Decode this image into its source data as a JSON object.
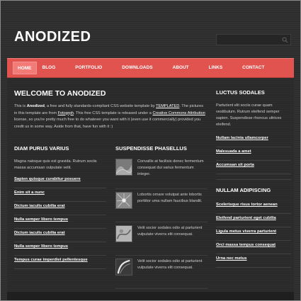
{
  "site": {
    "logo": "ANODIZED"
  },
  "search": {
    "placeholder": ""
  },
  "nav": {
    "items": [
      "HOME",
      "BLOG",
      "PORTFOLIO",
      "DOWNLOADS",
      "ABOUT",
      "LINKS",
      "CONTACT"
    ],
    "active": "HOME"
  },
  "welcome": {
    "title": "WELCOME TO ANODIZED",
    "p1": "This is ",
    "brand": "Anodized",
    "p2": ", a free and fully standards-compliant CSS website template by ",
    "templated": "TEMPLATED",
    "p3": ". The pictures in this template are from ",
    "fotogrph": "Fotogrph",
    "p4": ". This free CSS template is released under a ",
    "license": "Creative Commons Attribution",
    "p5": " license, so you're pretty much free to do whatever you want with it (even use it commercially) provided you credit us in some way. Aside from that, have fun with it :)"
  },
  "col1": {
    "title": "DIAM PURUS VARIUS",
    "text": "Magna natoque quis est gravida. Rutrum sociis massa accumsan vulputate velit.",
    "links": [
      "Sapien quisque curabitur posuere",
      "Enim sit a nunc",
      "Dictum iaculis cubilia erat",
      "Nulla semper libero tempus",
      "Dictum iaculis cubilia erat",
      "Nulla semper libero tempus",
      "Tempus curae imperdiet pellentesque"
    ]
  },
  "col2": {
    "title": "SUSPENDISSE PHASELLUS",
    "items": [
      "Convallis at facilisis donec fermentum consequat dui varius fermentum integer.",
      "Lobortis ornare volutpat ante lobortis porttitor uma nullam faucibus blandit.",
      "Velit socior sodales odio at parturient vulputate viverra elit consequat.",
      "Velit socior sodales odio at parturient vulputate viverra elit consequat."
    ]
  },
  "col3": {
    "title1": "LUCTUS SODALES",
    "text": "Parturient elit sociis curae quam vestibulum. Rutrum eleifend semper sapien. Suspendisse rhoncus ultrices eleifend.",
    "links1": [
      "Nullam lacinia ullamcorper",
      "Malesuada a amet",
      "Accumsan sit porta"
    ],
    "title2": "NULLAM ADIPISCING",
    "links2": [
      "Scelerisque risus tortor aenean",
      "Eleifend parturient eget cubilia",
      "Ligula metus viverra parturient",
      "Orci massa tempus consequat",
      "Urna nec metus"
    ]
  },
  "colors": {
    "accent": "#e0534f",
    "background": "#2e2e2e"
  }
}
